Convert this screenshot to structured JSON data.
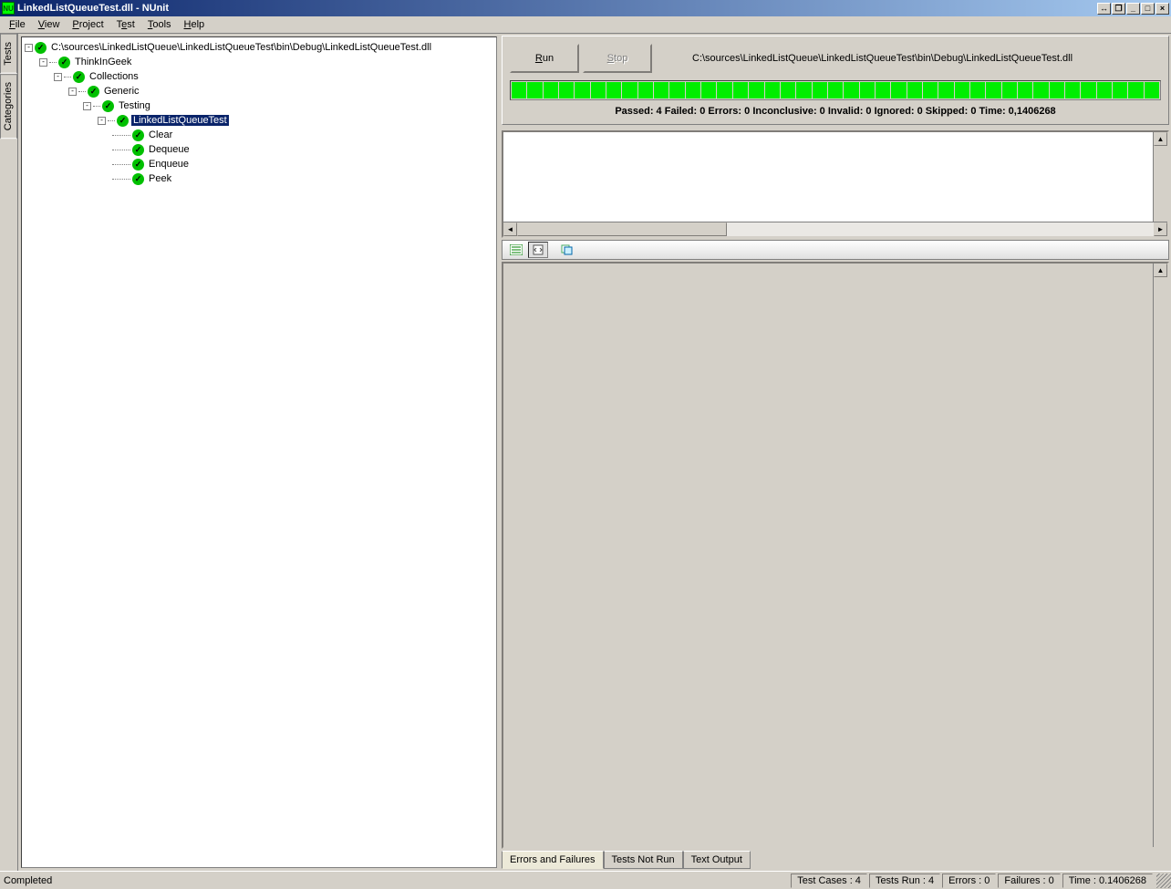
{
  "titlebar": {
    "app_icon_text": "NU",
    "title": "LinkedListQueueTest.dll - NUnit"
  },
  "menu": [
    "File",
    "View",
    "Project",
    "Test",
    "Tools",
    "Help"
  ],
  "side_tabs": [
    "Tests",
    "Categories"
  ],
  "tree": [
    {
      "indent": 0,
      "exp": "-",
      "dot": 0,
      "label": "C:\\sources\\LinkedListQueue\\LinkedListQueueTest\\bin\\Debug\\LinkedListQueueTest.dll",
      "selected": false
    },
    {
      "indent": 1,
      "exp": "-",
      "dot": 8,
      "label": "ThinkInGeek",
      "selected": false
    },
    {
      "indent": 2,
      "exp": "-",
      "dot": 8,
      "label": "Collections",
      "selected": false
    },
    {
      "indent": 3,
      "exp": "-",
      "dot": 8,
      "label": "Generic",
      "selected": false
    },
    {
      "indent": 4,
      "exp": "-",
      "dot": 8,
      "label": "Testing",
      "selected": false
    },
    {
      "indent": 5,
      "exp": "-",
      "dot": 8,
      "label": "LinkedListQueueTest",
      "selected": true
    },
    {
      "indent": 6,
      "exp": "",
      "dot": 20,
      "label": "Clear",
      "selected": false
    },
    {
      "indent": 6,
      "exp": "",
      "dot": 20,
      "label": "Dequeue",
      "selected": false
    },
    {
      "indent": 6,
      "exp": "",
      "dot": 20,
      "label": "Enqueue",
      "selected": false
    },
    {
      "indent": 6,
      "exp": "",
      "dot": 20,
      "label": "Peek",
      "selected": false
    }
  ],
  "run": {
    "run_label": "Run",
    "stop_label": "Stop",
    "path": "C:\\sources\\LinkedListQueue\\LinkedListQueueTest\\bin\\Debug\\LinkedListQueueTest.dll",
    "segments": 41,
    "summary": "Passed: 4  Failed: 0  Errors: 0  Inconclusive: 0  Invalid: 0  Ignored: 0  Skipped: 0  Time: 0,1406268"
  },
  "bottom_tabs": [
    "Errors and Failures",
    "Tests Not Run",
    "Text Output"
  ],
  "active_bottom_tab": 0,
  "status": {
    "left": "Completed",
    "cells": [
      "Test Cases : 4",
      "Tests Run : 4",
      "Errors : 0",
      "Failures : 0",
      "Time : 0.1406268"
    ]
  }
}
